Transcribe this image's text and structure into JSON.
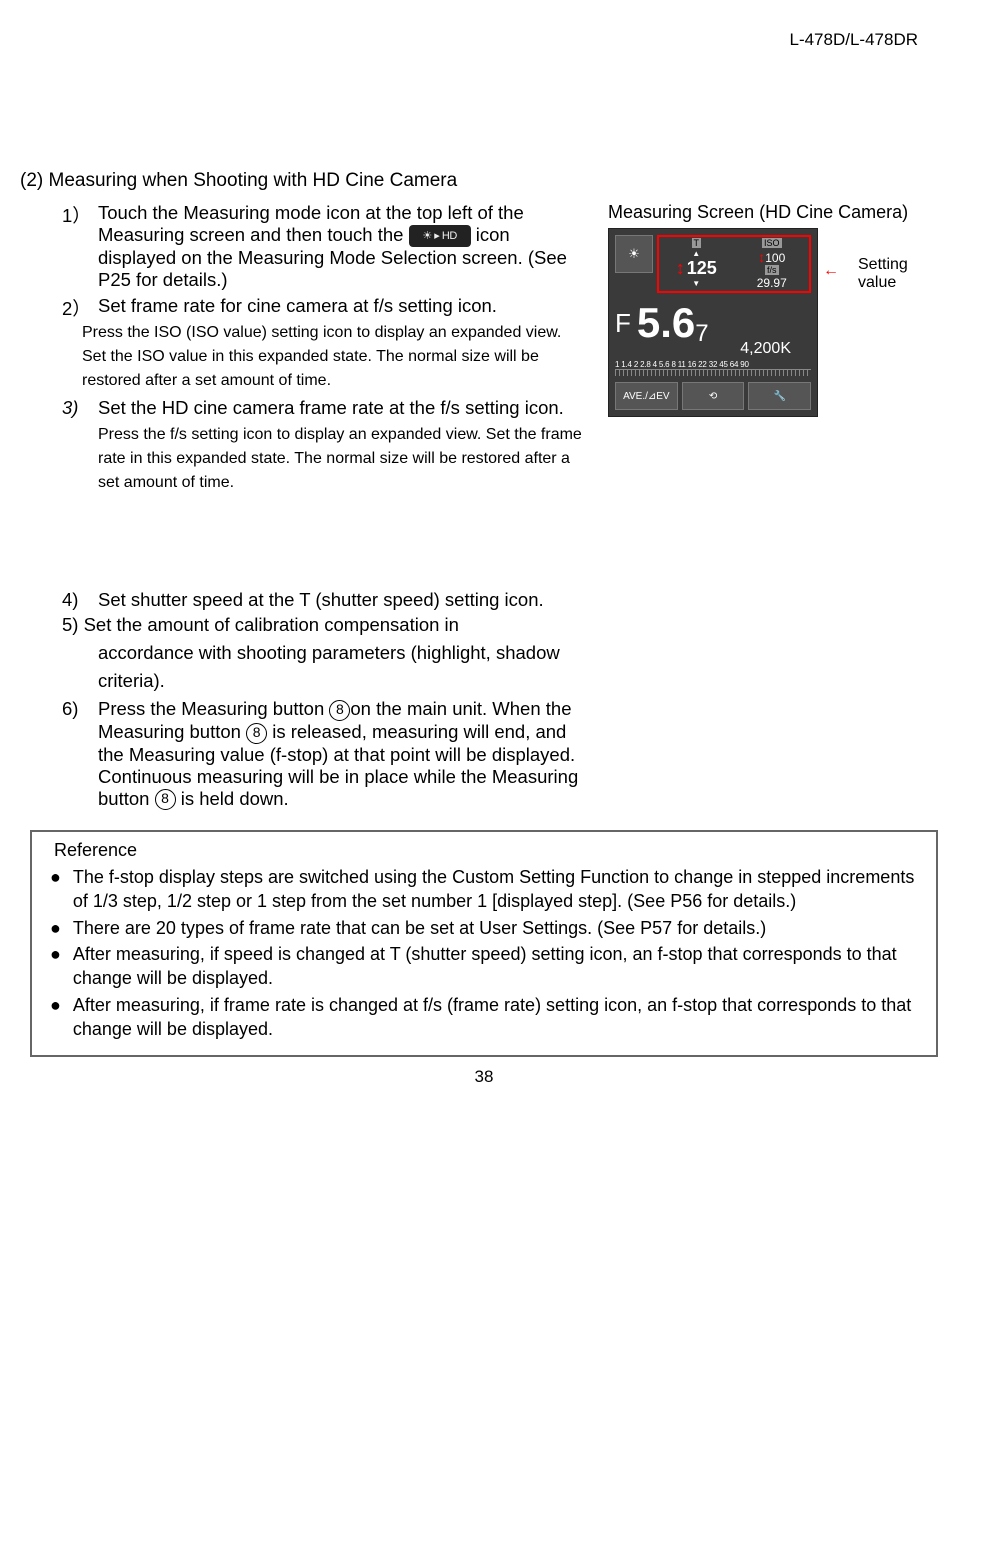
{
  "header": {
    "model": "L-478D/L-478DR"
  },
  "section": {
    "title": "(2) Measuring when Shooting with HD Cine Camera"
  },
  "right": {
    "title": "Measuring Screen (HD Cine Camera)",
    "setting_label": "Setting value"
  },
  "screen": {
    "t_label": "T",
    "t_value": "125",
    "iso_label": "ISO",
    "iso_value": "100",
    "fs_label": "f/s",
    "fs_value": "29.97",
    "f_label": "F",
    "f_value": "5.6",
    "f_sub": "7",
    "kelvin": "4,200",
    "kelvin_suffix": "K",
    "scale": "1 1.4 2 2.8 4 5.6 8 11 16 22 32 45 64 90",
    "btn1": "AVE./⊿EV",
    "btn2": "⟲",
    "btn3": "🔧"
  },
  "steps": {
    "s1": {
      "num": "1）",
      "text_a": "Touch the Measuring mode icon at the top left of the Measuring screen and then touch the",
      "text_b": "icon displayed on the Measuring Mode Selection screen. (See P25 for details.)"
    },
    "s2": {
      "num": "2）",
      "text": "Set frame rate for cine camera at f/s setting icon.",
      "sub": "Press the ISO (ISO value) setting icon to display an expanded view. Set the ISO value in this expanded state. The normal size will be restored after a set amount of time."
    },
    "s3": {
      "num": "3)",
      "text": "Set the HD cine camera frame rate at the f/s setting icon.",
      "sub": "Press the f/s setting icon to display an expanded view. Set the frame rate in this expanded state. The normal size will be restored after a set amount of time."
    },
    "s4": {
      "num": "4)",
      "text": "Set shutter speed at the T (shutter speed) setting icon."
    },
    "s5": {
      "num": "5)",
      "prefix": "Set the amount of calibration compensation in",
      "body": "accordance with shooting parameters (highlight, shadow criteria)."
    },
    "s6": {
      "num": "6)",
      "circ": "8",
      "text_a": "Press the Measuring button ",
      "text_b": "on the main unit. When the Measuring button ",
      "text_c": " is released, measuring will end, and the Measuring value (f-stop) at that point will be displayed. Continuous measuring will be in place while the Measuring button ",
      "text_d": " is held down."
    }
  },
  "reference": {
    "title": "Reference",
    "items": [
      "The f-stop display steps are switched using the Custom Setting Function to change in stepped increments of 1/3 step, 1/2 step or 1 step from the set number 1 [displayed step]. (See P56 for details.)",
      "There are 20 types of frame rate that can be set at User Settings. (See P57 for details.)",
      "After measuring, if speed is changed at T (shutter speed) setting icon, an f-stop that corresponds to that change will be displayed.",
      "After measuring, if frame rate is changed at f/s (frame rate) setting icon, an f-stop that corresponds to that change will be displayed."
    ]
  },
  "page_num": "38"
}
